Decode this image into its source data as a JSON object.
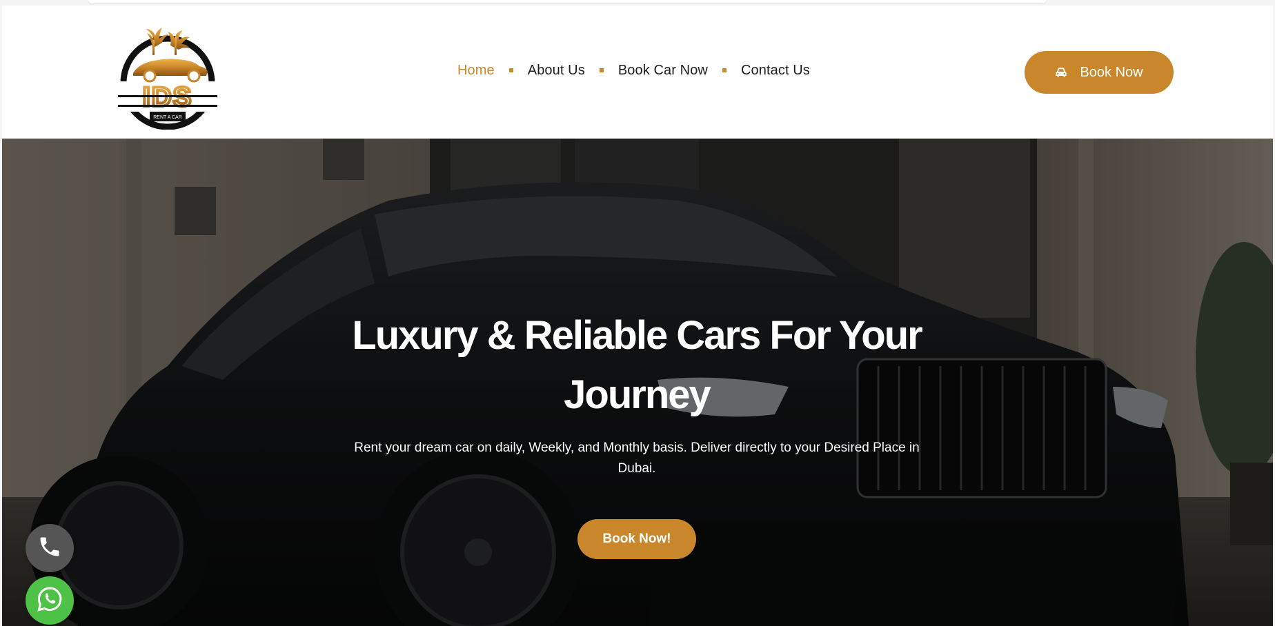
{
  "brand": {
    "logo_letters": "IDS",
    "logo_tagline": "RENT A CAR",
    "accent_color": "#c9862a"
  },
  "nav": {
    "items": [
      {
        "label": "Home",
        "active": true
      },
      {
        "label": "About Us",
        "active": false
      },
      {
        "label": "Book Car Now",
        "active": false
      },
      {
        "label": "Contact Us",
        "active": false
      }
    ]
  },
  "header": {
    "book_button_label": "Book Now",
    "book_button_icon": "car-icon"
  },
  "hero": {
    "title": "Luxury & Reliable Cars For Your Journey",
    "subtitle": "Rent your dream car on daily, Weekly, and Monthly basis. Deliver directly to your Desired Place in Dubai.",
    "cta_label": "Book Now!",
    "background_image": "black-luxury-car-front-of-building"
  },
  "floating": {
    "phone_icon": "phone-icon",
    "whatsapp_icon": "whatsapp-icon",
    "whatsapp_color": "#4dc247"
  }
}
